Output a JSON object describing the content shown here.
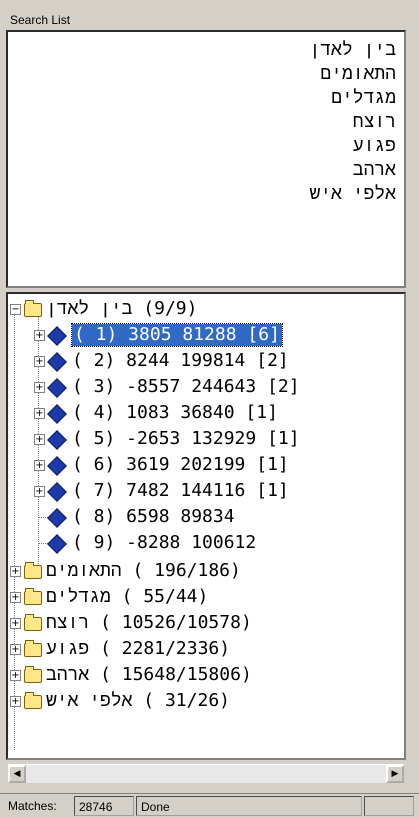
{
  "panel": {
    "title": "Search List"
  },
  "search_terms": [
    "בין לאדן",
    "התאומים",
    "מגדלים",
    "רוצח",
    "פגוע",
    "ארהב",
    "אלפי איש"
  ],
  "tree": {
    "root": {
      "label": "בין לאדן",
      "count": "(9/9)"
    },
    "children": [
      {
        "label": "( 1)   3805  81288  [6]"
      },
      {
        "label": "( 2)   8244  199814  [2]"
      },
      {
        "label": "( 3)  -8557  244643  [2]"
      },
      {
        "label": "( 4)   1083  36840  [1]"
      },
      {
        "label": "( 5)  -2653  132929  [1]"
      },
      {
        "label": "( 6)   3619  202199  [1]"
      },
      {
        "label": "( 7)   7482  144116  [1]"
      },
      {
        "label": "( 8)   6598  89834"
      },
      {
        "label": "( 9)  -8288  100612"
      }
    ],
    "folders": [
      {
        "label": "התאומים",
        "count": "( 196/186)"
      },
      {
        "label": "מגדלים",
        "count": "( 55/44)"
      },
      {
        "label": "רוצח",
        "count": "( 10526/10578)"
      },
      {
        "label": "פגוע",
        "count": "( 2281/2336)"
      },
      {
        "label": "ארהב",
        "count": "( 15648/15806)"
      },
      {
        "label": "אלפי איש",
        "count": "( 31/26)"
      }
    ]
  },
  "status": {
    "matches_label": "Matches:",
    "matches_value": "28746",
    "state": "Done"
  }
}
